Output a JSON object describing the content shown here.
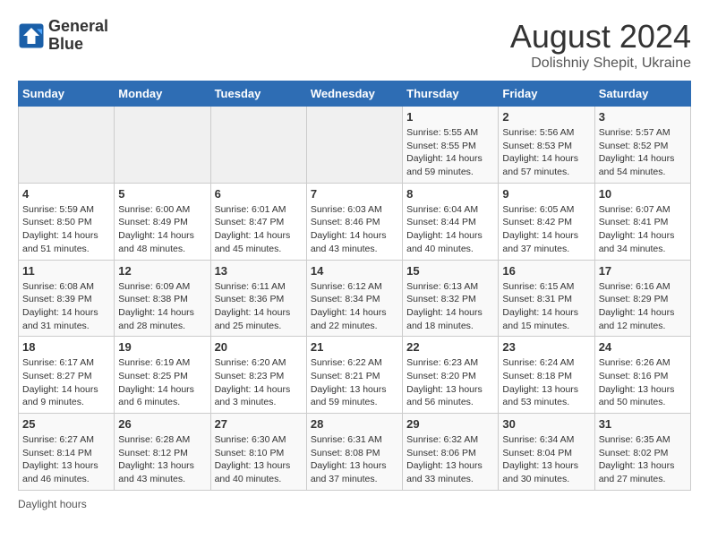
{
  "header": {
    "logo_line1": "General",
    "logo_line2": "Blue",
    "main_title": "August 2024",
    "subtitle": "Dolishniy Shepit, Ukraine"
  },
  "calendar": {
    "days_of_week": [
      "Sunday",
      "Monday",
      "Tuesday",
      "Wednesday",
      "Thursday",
      "Friday",
      "Saturday"
    ],
    "weeks": [
      [
        {
          "day": "",
          "info": ""
        },
        {
          "day": "",
          "info": ""
        },
        {
          "day": "",
          "info": ""
        },
        {
          "day": "",
          "info": ""
        },
        {
          "day": "1",
          "info": "Sunrise: 5:55 AM\nSunset: 8:55 PM\nDaylight: 14 hours and 59 minutes."
        },
        {
          "day": "2",
          "info": "Sunrise: 5:56 AM\nSunset: 8:53 PM\nDaylight: 14 hours and 57 minutes."
        },
        {
          "day": "3",
          "info": "Sunrise: 5:57 AM\nSunset: 8:52 PM\nDaylight: 14 hours and 54 minutes."
        }
      ],
      [
        {
          "day": "4",
          "info": "Sunrise: 5:59 AM\nSunset: 8:50 PM\nDaylight: 14 hours and 51 minutes."
        },
        {
          "day": "5",
          "info": "Sunrise: 6:00 AM\nSunset: 8:49 PM\nDaylight: 14 hours and 48 minutes."
        },
        {
          "day": "6",
          "info": "Sunrise: 6:01 AM\nSunset: 8:47 PM\nDaylight: 14 hours and 45 minutes."
        },
        {
          "day": "7",
          "info": "Sunrise: 6:03 AM\nSunset: 8:46 PM\nDaylight: 14 hours and 43 minutes."
        },
        {
          "day": "8",
          "info": "Sunrise: 6:04 AM\nSunset: 8:44 PM\nDaylight: 14 hours and 40 minutes."
        },
        {
          "day": "9",
          "info": "Sunrise: 6:05 AM\nSunset: 8:42 PM\nDaylight: 14 hours and 37 minutes."
        },
        {
          "day": "10",
          "info": "Sunrise: 6:07 AM\nSunset: 8:41 PM\nDaylight: 14 hours and 34 minutes."
        }
      ],
      [
        {
          "day": "11",
          "info": "Sunrise: 6:08 AM\nSunset: 8:39 PM\nDaylight: 14 hours and 31 minutes."
        },
        {
          "day": "12",
          "info": "Sunrise: 6:09 AM\nSunset: 8:38 PM\nDaylight: 14 hours and 28 minutes."
        },
        {
          "day": "13",
          "info": "Sunrise: 6:11 AM\nSunset: 8:36 PM\nDaylight: 14 hours and 25 minutes."
        },
        {
          "day": "14",
          "info": "Sunrise: 6:12 AM\nSunset: 8:34 PM\nDaylight: 14 hours and 22 minutes."
        },
        {
          "day": "15",
          "info": "Sunrise: 6:13 AM\nSunset: 8:32 PM\nDaylight: 14 hours and 18 minutes."
        },
        {
          "day": "16",
          "info": "Sunrise: 6:15 AM\nSunset: 8:31 PM\nDaylight: 14 hours and 15 minutes."
        },
        {
          "day": "17",
          "info": "Sunrise: 6:16 AM\nSunset: 8:29 PM\nDaylight: 14 hours and 12 minutes."
        }
      ],
      [
        {
          "day": "18",
          "info": "Sunrise: 6:17 AM\nSunset: 8:27 PM\nDaylight: 14 hours and 9 minutes."
        },
        {
          "day": "19",
          "info": "Sunrise: 6:19 AM\nSunset: 8:25 PM\nDaylight: 14 hours and 6 minutes."
        },
        {
          "day": "20",
          "info": "Sunrise: 6:20 AM\nSunset: 8:23 PM\nDaylight: 14 hours and 3 minutes."
        },
        {
          "day": "21",
          "info": "Sunrise: 6:22 AM\nSunset: 8:21 PM\nDaylight: 13 hours and 59 minutes."
        },
        {
          "day": "22",
          "info": "Sunrise: 6:23 AM\nSunset: 8:20 PM\nDaylight: 13 hours and 56 minutes."
        },
        {
          "day": "23",
          "info": "Sunrise: 6:24 AM\nSunset: 8:18 PM\nDaylight: 13 hours and 53 minutes."
        },
        {
          "day": "24",
          "info": "Sunrise: 6:26 AM\nSunset: 8:16 PM\nDaylight: 13 hours and 50 minutes."
        }
      ],
      [
        {
          "day": "25",
          "info": "Sunrise: 6:27 AM\nSunset: 8:14 PM\nDaylight: 13 hours and 46 minutes."
        },
        {
          "day": "26",
          "info": "Sunrise: 6:28 AM\nSunset: 8:12 PM\nDaylight: 13 hours and 43 minutes."
        },
        {
          "day": "27",
          "info": "Sunrise: 6:30 AM\nSunset: 8:10 PM\nDaylight: 13 hours and 40 minutes."
        },
        {
          "day": "28",
          "info": "Sunrise: 6:31 AM\nSunset: 8:08 PM\nDaylight: 13 hours and 37 minutes."
        },
        {
          "day": "29",
          "info": "Sunrise: 6:32 AM\nSunset: 8:06 PM\nDaylight: 13 hours and 33 minutes."
        },
        {
          "day": "30",
          "info": "Sunrise: 6:34 AM\nSunset: 8:04 PM\nDaylight: 13 hours and 30 minutes."
        },
        {
          "day": "31",
          "info": "Sunrise: 6:35 AM\nSunset: 8:02 PM\nDaylight: 13 hours and 27 minutes."
        }
      ]
    ]
  },
  "footer": {
    "note": "Daylight hours"
  }
}
